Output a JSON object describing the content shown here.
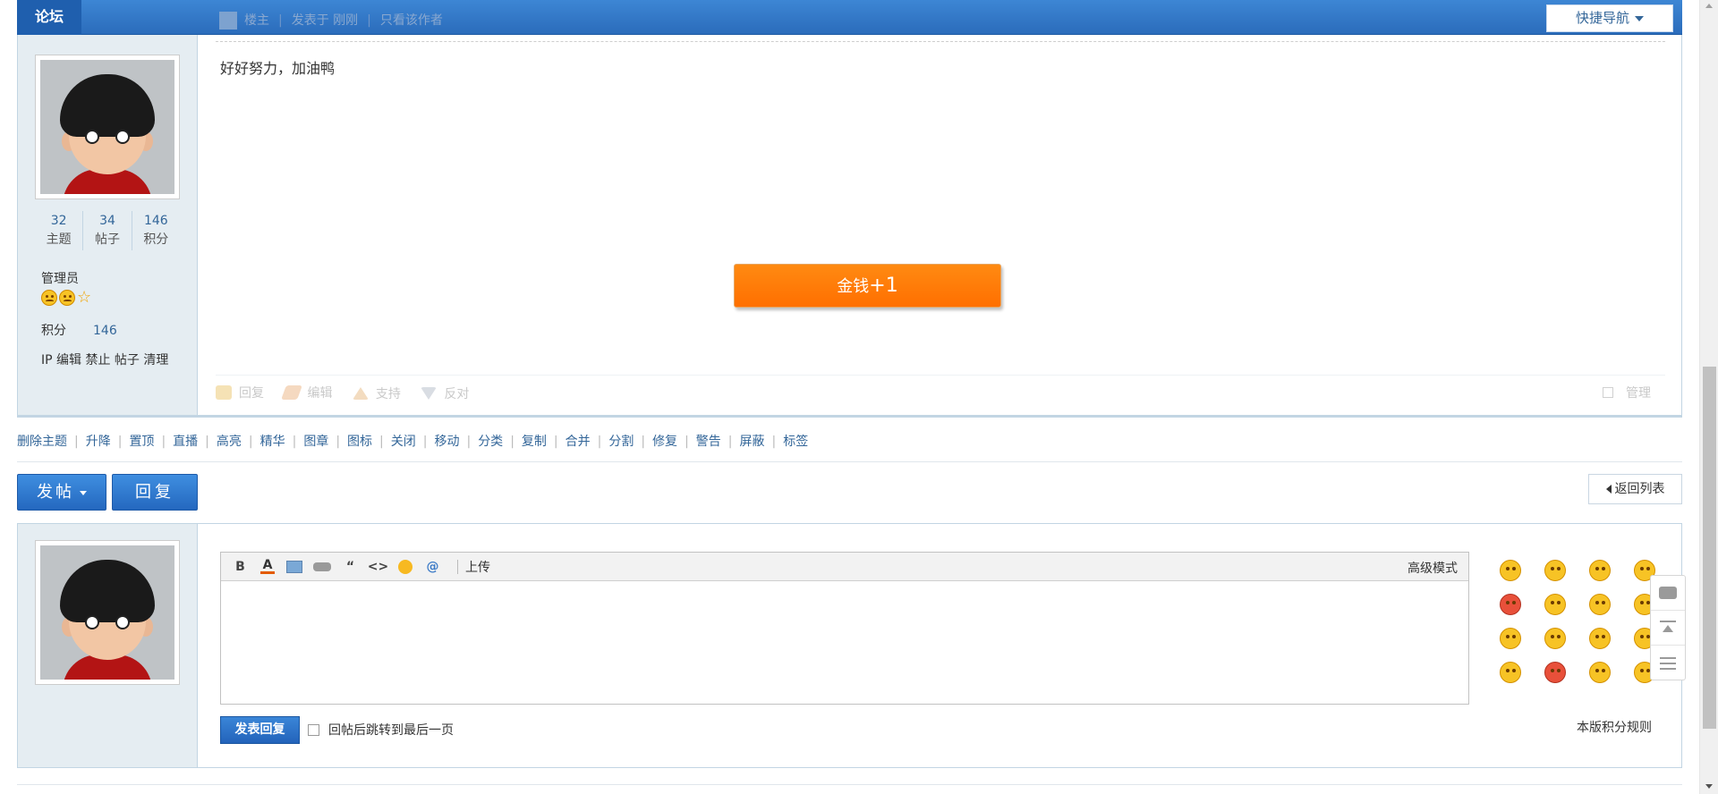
{
  "topbar": {
    "forum_tab": "论坛",
    "quick_nav": "快捷导航",
    "author": "楼主",
    "posted": "发表于 刚刚",
    "only_author": "只看该作者"
  },
  "post": {
    "content": "好好努力，加油鸭",
    "toast_label": "金钱",
    "toast_amount": "+1",
    "stats": [
      {
        "num": "32",
        "label": "主题"
      },
      {
        "num": "34",
        "label": "帖子"
      },
      {
        "num": "146",
        "label": "积分"
      }
    ],
    "role": "管理员",
    "score_label": "积分",
    "score_value": "146",
    "mod_links": "IP 编辑 禁止 帖子 清理",
    "actions": {
      "reply": "回复",
      "edit": "编辑",
      "support": "支持",
      "oppose": "反对",
      "manage": "管理"
    }
  },
  "modbar": [
    "删除主题",
    "升降",
    "置顶",
    "直播",
    "高亮",
    "精华",
    "图章",
    "图标",
    "关闭",
    "移动",
    "分类",
    "复制",
    "合并",
    "分割",
    "修复",
    "警告",
    "屏蔽",
    "标签"
  ],
  "buttons": {
    "post": "发帖",
    "reply": "回复",
    "back": "返回列表"
  },
  "editor": {
    "bold": "B",
    "color": "A",
    "quote": "“",
    "code": "<>",
    "at": "@",
    "upload": "上传",
    "advanced": "高级模式",
    "submit": "发表回复",
    "jump_last": "回帖后跳转到最后一页",
    "rules": "本版积分规则"
  },
  "colors": {
    "accent": "#2b6cbb",
    "link": "#336699",
    "toast": "#ff7a00",
    "sidebar_bg": "#e5edf2"
  }
}
